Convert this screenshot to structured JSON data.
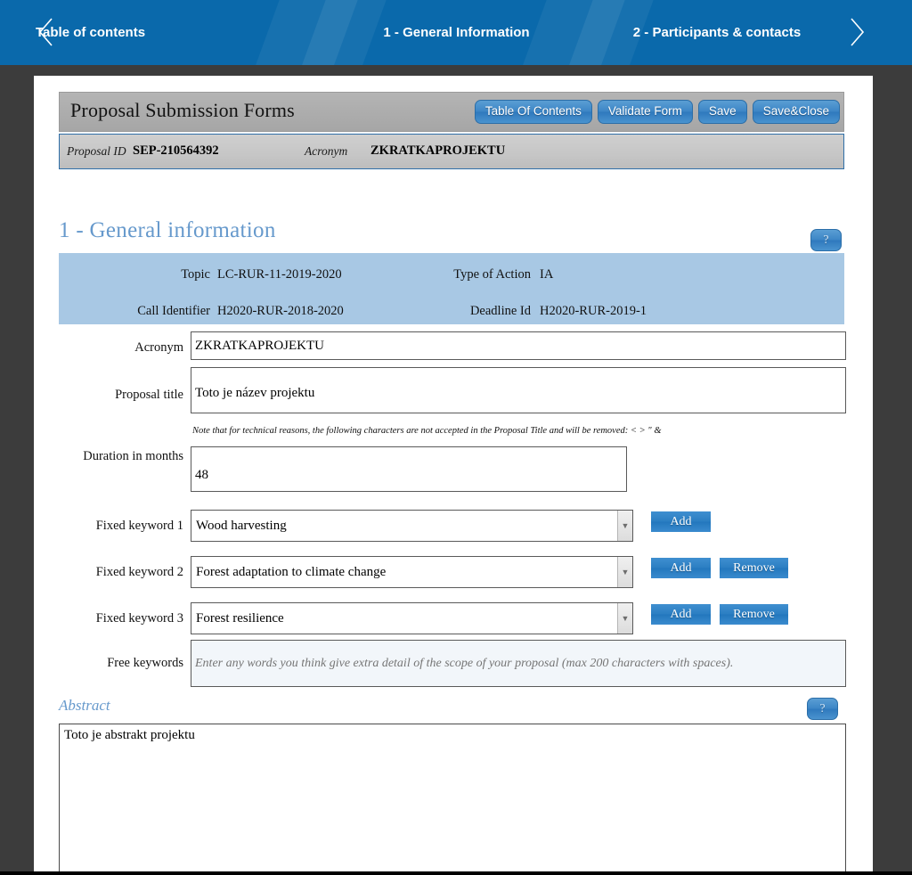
{
  "topnav": {
    "prev_icon": "chevron-left-icon",
    "next_icon": "chevron-right-icon",
    "toc_label": "Table of contents",
    "step1_label": "1 - General Information",
    "step2_label": "2 - Participants & contacts",
    "background_color": "#0a69ab"
  },
  "formbar": {
    "title": "Proposal Submission Forms",
    "buttons": [
      {
        "label": "Table Of Contents",
        "name": "table-of-contents-button"
      },
      {
        "label": "Validate Form",
        "name": "validate-form-button"
      },
      {
        "label": "Save",
        "name": "save-button"
      },
      {
        "label": "Save&Close",
        "name": "save-and-close-button"
      }
    ],
    "accent_color": "#2f79bd"
  },
  "idstrip": {
    "proposal_id_label": "Proposal ID",
    "proposal_id_value": "SEP-210564392",
    "acronym_label": "Acronym",
    "acronym_value": "ZKRATKAPROJEKTU"
  },
  "section": {
    "heading": "1 - General information",
    "heading_color": "#6699cc",
    "help_label": "?"
  },
  "info_panel": {
    "background_color": "#a8c8e4",
    "topic_label": "Topic",
    "topic_value": "LC-RUR-11-2019-2020",
    "type_of_action_label": "Type of Action",
    "type_of_action_value": "IA",
    "call_identifier_label": "Call Identifier",
    "call_identifier_value": "H2020-RUR-2018-2020",
    "deadline_id_label": "Deadline Id",
    "deadline_id_value": "H2020-RUR-2019-1"
  },
  "fields": {
    "acronym_label": "Acronym",
    "acronym_value": "ZKRATKAPROJEKTU",
    "proposal_title_label": "Proposal title",
    "proposal_title_value": "Toto je název projektu",
    "proposal_title_note": "Note that for technical reasons, the following characters are not accepted in the Proposal Title and will be removed: < > \" &",
    "duration_label": "Duration in months",
    "duration_value": "48",
    "keyword1_label": "Fixed keyword 1",
    "keyword1_value": "Wood harvesting",
    "keyword2_label": "Fixed keyword 2",
    "keyword2_value": "Forest adaptation to climate change",
    "keyword3_label": "Fixed keyword 3",
    "keyword3_value": "Forest resilience",
    "add_label": "Add",
    "remove_label": "Remove",
    "free_keywords_label": "Free keywords",
    "free_keywords_placeholder": "Enter any words you think give extra detail of the scope of your proposal (max 200 characters with spaces)."
  },
  "abstract": {
    "label": "Abstract",
    "help_label": "?",
    "value": "Toto je abstrakt projektu"
  }
}
